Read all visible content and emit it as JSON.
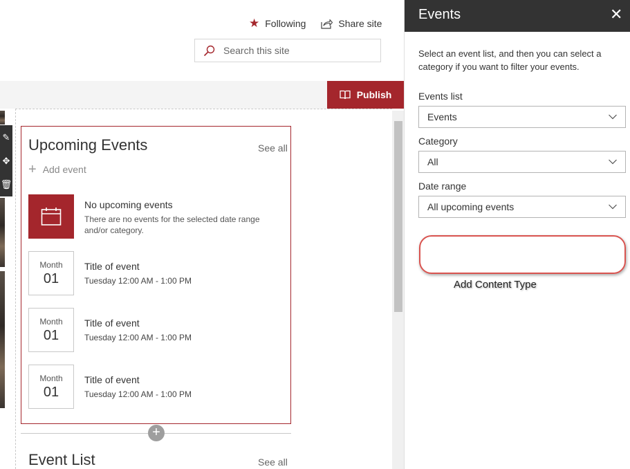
{
  "header": {
    "following_label": "Following",
    "share_label": "Share site",
    "search_placeholder": "Search this site"
  },
  "toolbar": {
    "publish_label": "Publish"
  },
  "upcoming_events": {
    "title": "Upcoming Events",
    "see_all_label": "See all",
    "add_event_label": "Add event",
    "no_events_title": "No upcoming events",
    "no_events_desc": "There are no events for the selected date range and/or category.",
    "events": [
      {
        "month": "Month",
        "day": "01",
        "title": "Title of event",
        "time": "Tuesday 12:00 AM - 1:00 PM"
      },
      {
        "month": "Month",
        "day": "01",
        "title": "Title of event",
        "time": "Tuesday 12:00 AM - 1:00 PM"
      },
      {
        "month": "Month",
        "day": "01",
        "title": "Title of event",
        "time": "Tuesday 12:00 AM - 1:00 PM"
      }
    ]
  },
  "event_list": {
    "title": "Event List",
    "see_all_label": "See all"
  },
  "panel": {
    "title": "Events",
    "description": "Select an event list, and then you can select a category if you want to filter your events.",
    "events_list_label": "Events list",
    "events_list_value": "Events",
    "category_label": "Category",
    "category_value": "All",
    "date_range_label": "Date range",
    "date_range_value": "All upcoming events",
    "callout_label": "Add Content Type"
  },
  "colors": {
    "accent": "#a4262c",
    "panel_header": "#333333",
    "callout": "#d9534f"
  }
}
